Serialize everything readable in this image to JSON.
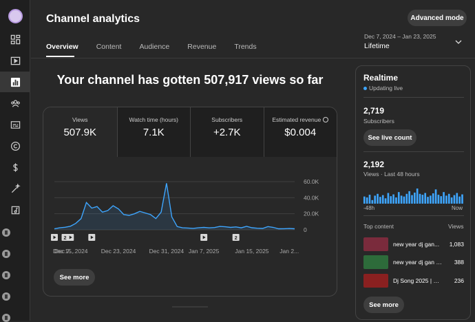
{
  "sidebar": {
    "items": [
      "dashboard-icon",
      "content-icon",
      "analytics-icon",
      "community-icon",
      "subtitles-icon",
      "copyright-icon",
      "earn-icon",
      "customization-icon",
      "audio-library-icon"
    ]
  },
  "header": {
    "title": "Channel analytics",
    "advanced_mode": "Advanced mode"
  },
  "tabs": [
    "Overview",
    "Content",
    "Audience",
    "Revenue",
    "Trends"
  ],
  "date_filter": {
    "range": "Dec 7, 2024 – Jan 23, 2025",
    "value": "Lifetime"
  },
  "headline": "Your channel has gotten 507,917 views so far",
  "metrics": [
    {
      "label": "Views",
      "value": "507.9K"
    },
    {
      "label": "Watch time (hours)",
      "value": "7.1K"
    },
    {
      "label": "Subscribers",
      "value": "+2.7K"
    },
    {
      "label": "Estimated revenue",
      "value": "$0.004"
    }
  ],
  "chart_data": {
    "type": "area",
    "series": [
      {
        "values": [
          1200,
          2500,
          3200,
          4500,
          8000,
          14000,
          34000,
          27000,
          29000,
          22000,
          24000,
          30000,
          26000,
          19000,
          18000,
          20000,
          23000,
          21000,
          19000,
          14000,
          22000,
          58000,
          16000,
          4000,
          2500,
          2200,
          1800,
          2500,
          3000,
          2400,
          2800,
          4200,
          3800,
          3000,
          3600,
          2500,
          4300,
          2600,
          2000,
          1700,
          4000,
          3000,
          1300,
          1400,
          1600,
          1300
        ]
      }
    ],
    "x_tick_labels": [
      "Dec 7...",
      "Dec 15, 2024",
      "Dec 23, 2024",
      "Dec 31, 2024",
      "Jan 7, 2025",
      "Jan 15, 2025",
      "Jan 2..."
    ],
    "y_tick_labels": [
      "60.0K",
      "40.0K",
      "20.0K",
      "0"
    ],
    "ylim": [
      0,
      60000
    ],
    "color": "#3ea6ff",
    "markers": [
      {
        "index": 0,
        "label": ""
      },
      {
        "index": 2,
        "label": "2"
      },
      {
        "index": 3,
        "label": ""
      },
      {
        "index": 7,
        "label": ""
      },
      {
        "index": 28,
        "label": ""
      },
      {
        "index": 34,
        "label": "2"
      }
    ]
  },
  "card_see_more": "See more",
  "realtime": {
    "title": "Realtime",
    "status": "Updating live",
    "subscribers_value": "2,719",
    "subscribers_label": "Subscribers",
    "live_count_button": "See live count",
    "views_value": "2,192",
    "views_label": "Views · Last 48 hours",
    "spark_values": [
      40,
      35,
      50,
      20,
      45,
      55,
      38,
      48,
      30,
      60,
      42,
      52,
      35,
      65,
      45,
      40,
      55,
      70,
      48,
      62,
      85,
      55,
      50,
      60,
      38,
      45,
      58,
      80,
      50,
      42,
      65,
      45,
      55,
      35,
      48,
      60,
      40,
      52
    ],
    "spark_left": "-48h",
    "spark_right": "Now",
    "top_content_label": "Top content",
    "top_content_metric": "Views",
    "top_content": [
      {
        "title": "new year dj gan...",
        "views": "1,083",
        "thumb_color": "#7a2b3c"
      },
      {
        "title": "new year dj gan 2...",
        "views": "388",
        "thumb_color": "#2d6b3a"
      },
      {
        "title": "Dj Song 2025 | Dj...",
        "views": "236",
        "thumb_color": "#8a2020"
      }
    ],
    "see_more": "See more"
  }
}
